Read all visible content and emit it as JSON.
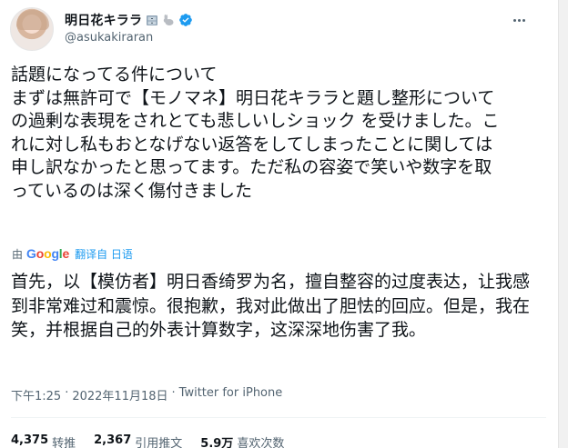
{
  "author": {
    "display_name": "明日花キララ",
    "handle": "@asukakiraran",
    "emojis": [
      "file-cabinet-emoji",
      "rabbit-emoji"
    ],
    "verified": true
  },
  "tweet": {
    "text": "話題になってる件について\nまずは無許可で【モノマネ】明日花キララと題し整形についての過剰な表現をされとても悲しいしショック を受けました。これに対し私もおとなげない返答をしてしまったことに関しては申し訳なかったと思ってます。ただ私の容姿で笑いや数字を取っているのは深く傷付きました"
  },
  "translation": {
    "prefix": "由",
    "provider": "Google",
    "provider_letters": [
      "G",
      "o",
      "o",
      "g",
      "l",
      "e"
    ],
    "provider_colors": [
      "#4285F4",
      "#EA4335",
      "#FBBC05",
      "#4285F4",
      "#34A853",
      "#EA4335"
    ],
    "link_text": "翻译自 日语",
    "text": "首先，以【模仿者】明日香绮罗为名，擅自整容的过度表达，让我感到非常难过和震惊。很抱歉，我对此做出了胆怯的回应。但是，我在笑，并根据自己的外表计算数字，这深深地伤害了我。"
  },
  "meta": {
    "time": "下午1:25",
    "separator1": "·",
    "date": "2022年11月18日",
    "separator2": "·",
    "source": "Twitter for iPhone"
  },
  "stats": {
    "retweets_count": "4,375",
    "retweets_label": "转推",
    "quotes_count": "2,367",
    "quotes_label": "引用推文",
    "likes_count": "5.9万",
    "likes_label": "喜欢次数"
  },
  "colors": {
    "accent": "#1d9bf0",
    "secondary_text": "#536471",
    "primary_text": "#0f1419"
  }
}
